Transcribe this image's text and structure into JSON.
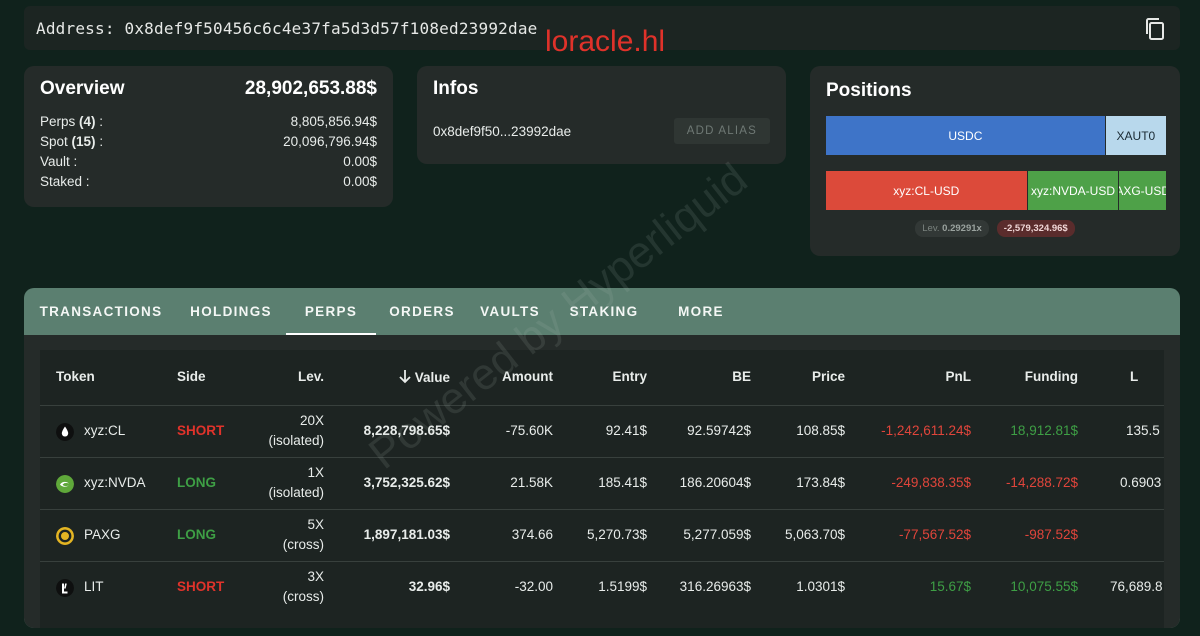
{
  "address_bar": {
    "label": "Address:",
    "address": "0x8def9f50456c6c4e37fa5d3d57f108ed23992dae"
  },
  "watermark_text": "loracle.hl",
  "overview": {
    "title": "Overview",
    "total": "28,902,653.88$",
    "rows": [
      {
        "label": "Perps",
        "count": "(4)",
        "suffix": " :",
        "value": "8,805,856.94$"
      },
      {
        "label": "Spot",
        "count": "(15)",
        "suffix": " :",
        "value": "20,096,796.94$"
      },
      {
        "label": "Vault",
        "count": "",
        "suffix": " :",
        "value": "0.00$"
      },
      {
        "label": "Staked",
        "count": "",
        "suffix": " :",
        "value": "0.00$"
      }
    ]
  },
  "infos": {
    "title": "Infos",
    "short_address": "0x8def9f50...23992dae",
    "alias_button": "ADD ALIAS"
  },
  "positions": {
    "title": "Positions",
    "spot_bar": [
      {
        "label": "USDC",
        "color": "#3e74c8",
        "share": 0.82
      },
      {
        "label": "XAUT0",
        "color": "#b8d8ec",
        "share": 0.18
      }
    ],
    "perp_bar": [
      {
        "label": "xyz:CL-USD",
        "color": "#dc4a3a",
        "share": 0.59
      },
      {
        "label": "xyz:NVDA-USD",
        "color": "#4ea148",
        "share": 0.27
      },
      {
        "label": "AXG-USD",
        "color": "#4ea148",
        "share": 0.14
      }
    ],
    "lev_label": "Lev.",
    "lev_value": "0.29291x",
    "pnl_value": "-2,579,324.96$"
  },
  "tabs": [
    "TRANSACTIONS",
    "HOLDINGS",
    "PERPS",
    "ORDERS",
    "VAULTS",
    "STAKING",
    "MORE"
  ],
  "active_tab": "PERPS",
  "table": {
    "headers": {
      "token": "Token",
      "side": "Side",
      "lev": "Lev.",
      "value": "Value",
      "amount": "Amount",
      "entry": "Entry",
      "be": "BE",
      "price": "Price",
      "pnl": "PnL",
      "funding": "Funding",
      "liq": "L"
    },
    "rows": [
      {
        "token": "xyz:CL",
        "icon": "oil-drop-icon",
        "side": "SHORT",
        "lev": "20X",
        "mode": "(isolated)",
        "value": "8,228,798.65$",
        "amount": "-75.60K",
        "entry": "92.41$",
        "be": "92.59742$",
        "price": "108.85$",
        "pnl": "-1,242,611.24$",
        "funding": "18,912.81$",
        "liq": "135.5"
      },
      {
        "token": "xyz:NVDA",
        "icon": "nvidia-icon",
        "side": "LONG",
        "lev": "1X",
        "mode": "(isolated)",
        "value": "3,752,325.62$",
        "amount": "21.58K",
        "entry": "185.41$",
        "be": "186.20604$",
        "price": "173.84$",
        "pnl": "-249,838.35$",
        "funding": "-14,288.72$",
        "liq": "0.6903"
      },
      {
        "token": "PAXG",
        "icon": "paxg-gold-icon",
        "side": "LONG",
        "lev": "5X",
        "mode": "(cross)",
        "value": "1,897,181.03$",
        "amount": "374.66",
        "entry": "5,270.73$",
        "be": "5,277.059$",
        "price": "5,063.70$",
        "pnl": "-77,567.52$",
        "funding": "-987.52$",
        "liq": ""
      },
      {
        "token": "LIT",
        "icon": "lit-icon",
        "side": "SHORT",
        "lev": "3X",
        "mode": "(cross)",
        "value": "32.96$",
        "amount": "-32.00",
        "entry": "1.5199$",
        "be": "316.26963$",
        "price": "1.0301$",
        "pnl": "15.67$",
        "funding": "10,075.55$",
        "liq": "76,689.8"
      }
    ]
  },
  "powered_watermark": "Powered by Hyperliquid"
}
